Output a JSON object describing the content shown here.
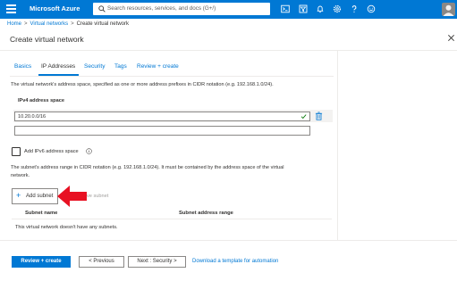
{
  "topbar": {
    "title": "Microsoft Azure",
    "search_placeholder": "Search resources, services, and docs (G+/)",
    "icons": [
      "menu-icon",
      "search-icon",
      "cloud-shell-icon",
      "directory-filter-icon",
      "notifications-icon",
      "settings-icon",
      "help-icon",
      "feedback-icon",
      "avatar"
    ]
  },
  "breadcrumb": [
    "Home",
    "Virtual networks",
    "Create virtual network"
  ],
  "page_title": "Create virtual network",
  "tabs": [
    {
      "label": "Basics",
      "active": false
    },
    {
      "label": "IP Addresses",
      "active": true
    },
    {
      "label": "Security",
      "active": false
    },
    {
      "label": "Tags",
      "active": false
    },
    {
      "label": "Review + create",
      "active": false
    }
  ],
  "address_space": {
    "description": "The virtual network's address space, specified as one or more address prefixes in CIDR notation (e.g. 192.168.1.0/24).",
    "label": "IPv4 address space",
    "value": "10.20.0.0/16",
    "empty_value": ""
  },
  "ipv6": {
    "label": "Add IPv6 address space",
    "checked": false
  },
  "subnets": {
    "description_line1": "The subnet's address range in CIDR notation (e.g. 192.168.1.0/24). It must be contained by the address space of the virtual",
    "description_line2": "network.",
    "add_label": "Add subnet",
    "remove_label_visible": "ve subnet",
    "columns": [
      "Subnet name",
      "Subnet address range"
    ],
    "empty_text": "This virtual network doesn't have any subnets."
  },
  "footer": {
    "review_create": "Review + create",
    "previous": "< Previous",
    "next": "Next : Security >",
    "download_link": "Download a template for automation"
  },
  "colors": {
    "accent": "#0078d4",
    "annotation_arrow": "#e81123"
  }
}
